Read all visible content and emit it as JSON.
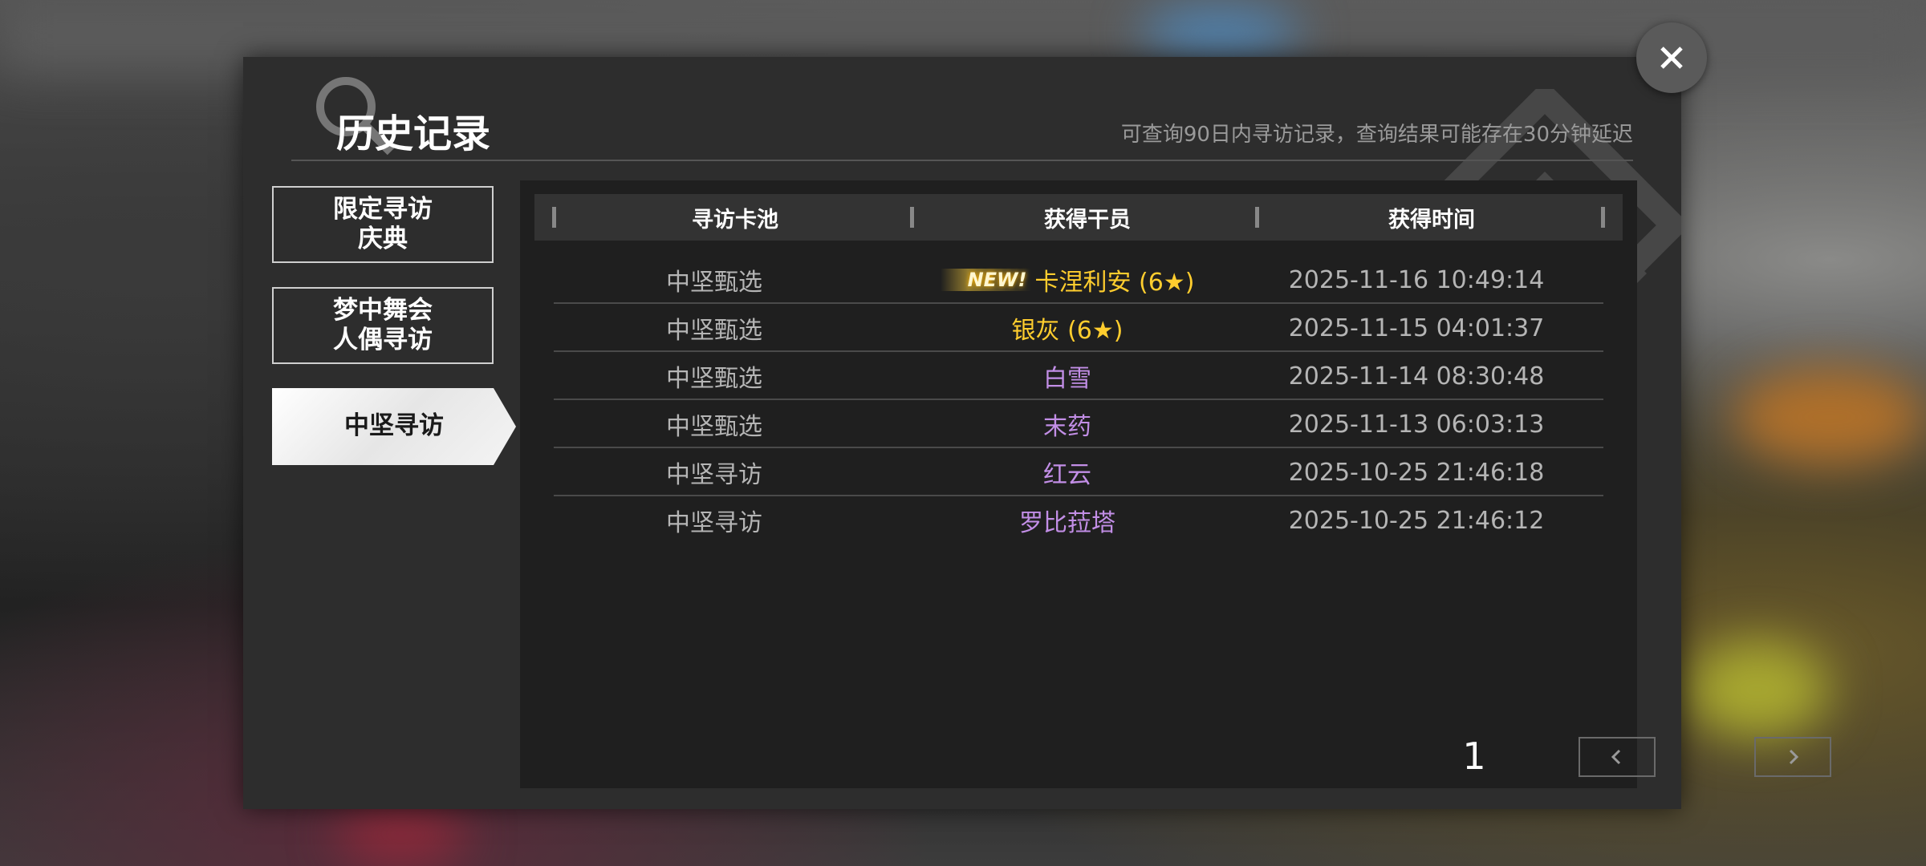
{
  "header": {
    "title": "历史记录",
    "subtitle": "可查询90日内寻访记录，查询结果可能存在30分钟延迟"
  },
  "tabs": [
    {
      "label": "限定寻访\n庆典",
      "active": false
    },
    {
      "label": "梦中舞会\n人偶寻访",
      "active": false
    },
    {
      "label": "中坚寻访",
      "active": true
    }
  ],
  "table": {
    "columns": [
      "寻访卡池",
      "获得干员",
      "获得时间"
    ],
    "rows": [
      {
        "pool": "中坚甄选",
        "new": "NEW!",
        "operator": "卡涅利安 (6★)",
        "time": "2025-11-16 10:49:14",
        "rarity_color": "#ffcd2e"
      },
      {
        "pool": "中坚甄选",
        "new": "",
        "operator": "银灰 (6★)",
        "time": "2025-11-15 04:01:37",
        "rarity_color": "#ffcd2e"
      },
      {
        "pool": "中坚甄选",
        "new": "",
        "operator": "白雪",
        "time": "2025-11-14 08:30:48",
        "rarity_color": "#c28ee6"
      },
      {
        "pool": "中坚甄选",
        "new": "",
        "operator": "末药",
        "time": "2025-11-13 06:03:13",
        "rarity_color": "#c28ee6"
      },
      {
        "pool": "中坚寻访",
        "new": "",
        "operator": "红云",
        "time": "2025-10-25 21:46:18",
        "rarity_color": "#c28ee6"
      },
      {
        "pool": "中坚寻访",
        "new": "",
        "operator": "罗比菈塔",
        "time": "2025-10-25 21:46:12",
        "rarity_color": "#c28ee6"
      }
    ]
  },
  "pager": {
    "page": "1",
    "prev_icon": "chevron-left-icon",
    "next_icon": "chevron-right-icon"
  },
  "close_icon": "close-icon"
}
